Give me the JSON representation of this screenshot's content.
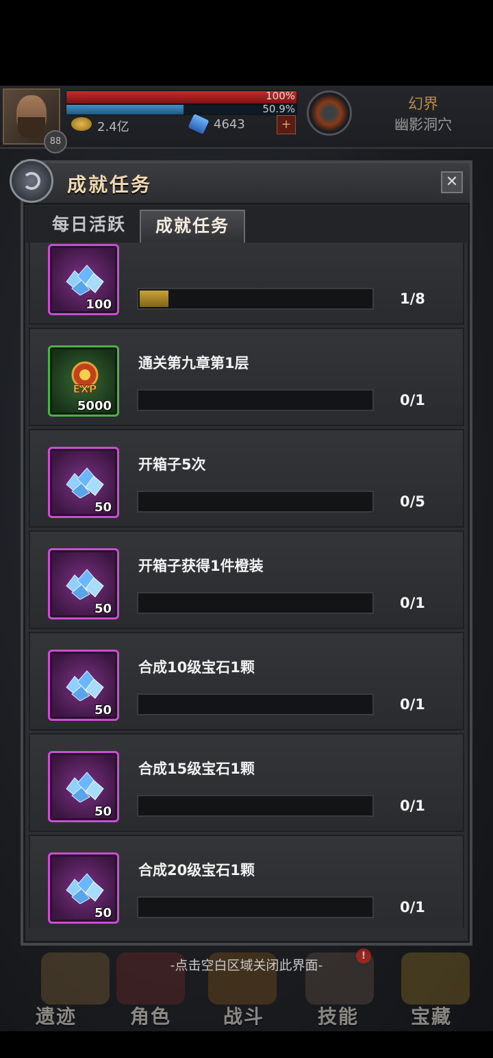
{
  "hud": {
    "level": "88",
    "hp_text": "100%",
    "hp_percent": 100,
    "mp_text": "50.9%",
    "mp_percent": 50.9,
    "gold": "2.4亿",
    "gems": "4643",
    "realm_title": "幻界",
    "realm_sub": "幽影洞穴"
  },
  "dialog": {
    "title": "成就任务",
    "close_label": "✕"
  },
  "tabs": [
    {
      "label": "每日活跃",
      "active": false
    },
    {
      "label": "成就任务",
      "active": true
    }
  ],
  "tasks": [
    {
      "title": "",
      "reward_type": "crystal",
      "reward_amount": "100",
      "progress_text": "1/8",
      "progress": 0.125
    },
    {
      "title": "通关第九章第1层",
      "reward_type": "exp",
      "reward_amount": "5000",
      "progress_text": "0/1",
      "progress": 0
    },
    {
      "title": "开箱子5次",
      "reward_type": "crystal",
      "reward_amount": "50",
      "progress_text": "0/5",
      "progress": 0
    },
    {
      "title": "开箱子获得1件橙装",
      "reward_type": "crystal",
      "reward_amount": "50",
      "progress_text": "0/1",
      "progress": 0
    },
    {
      "title": "合成10级宝石1颗",
      "reward_type": "crystal",
      "reward_amount": "50",
      "progress_text": "0/1",
      "progress": 0
    },
    {
      "title": "合成15级宝石1颗",
      "reward_type": "crystal",
      "reward_amount": "50",
      "progress_text": "0/1",
      "progress": 0
    },
    {
      "title": "合成20级宝石1颗",
      "reward_type": "crystal",
      "reward_amount": "50",
      "progress_text": "0/1",
      "progress": 0
    }
  ],
  "hint": "-点击空白区域关闭此界面-",
  "nav": [
    {
      "label": "遗迹",
      "badge": ""
    },
    {
      "label": "角色",
      "badge": ""
    },
    {
      "label": "战斗",
      "badge": ""
    },
    {
      "label": "技能",
      "badge": "!"
    },
    {
      "label": "宝藏",
      "badge": ""
    }
  ],
  "colors": {
    "purple_frame": "#c94fd1",
    "green_frame": "#4fb04a",
    "progress_gold": "#c9a23a",
    "title_gold": "#f0d9b0"
  }
}
